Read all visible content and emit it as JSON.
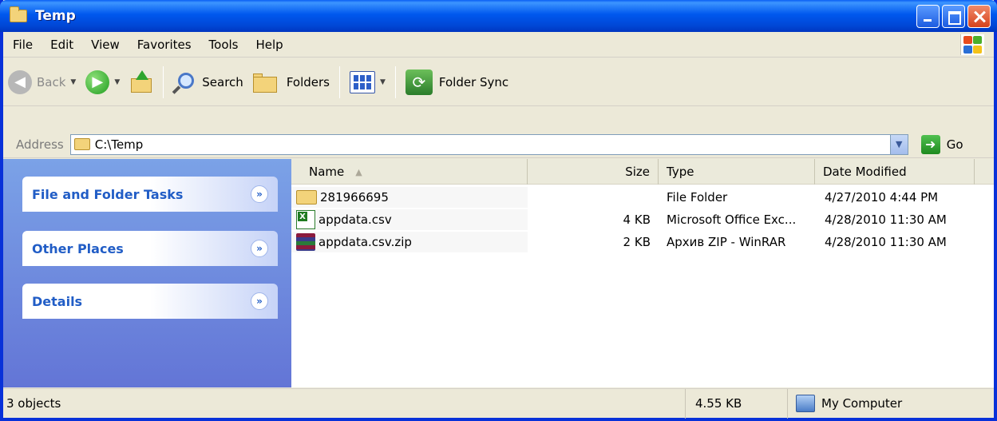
{
  "window": {
    "title": "Temp"
  },
  "menu": [
    "File",
    "Edit",
    "View",
    "Favorites",
    "Tools",
    "Help"
  ],
  "toolbar": {
    "back_label": "Back",
    "search_label": "Search",
    "folders_label": "Folders",
    "foldersync_label": "Folder Sync"
  },
  "address": {
    "label": "Address",
    "value": "C:\\Temp",
    "go_label": "Go"
  },
  "tasks": [
    {
      "title": "File and Folder Tasks"
    },
    {
      "title": "Other Places"
    },
    {
      "title": "Details"
    }
  ],
  "columns": {
    "name": "Name",
    "size": "Size",
    "type": "Type",
    "date": "Date Modified"
  },
  "files": [
    {
      "name": "281966695",
      "size": "",
      "type": "File Folder",
      "date": "4/27/2010 4:44 PM",
      "icon": "folder-icon"
    },
    {
      "name": "appdata.csv",
      "size": "4 KB",
      "type": "Microsoft Office Exc...",
      "date": "4/28/2010 11:30 AM",
      "icon": "excel-icon"
    },
    {
      "name": "appdata.csv.zip",
      "size": "2 KB",
      "type": "Архив ZIP - WinRAR",
      "date": "4/28/2010 11:30 AM",
      "icon": "winrar-icon"
    }
  ],
  "status": {
    "objects": "3 objects",
    "size": "4.55 KB",
    "location": "My Computer"
  }
}
